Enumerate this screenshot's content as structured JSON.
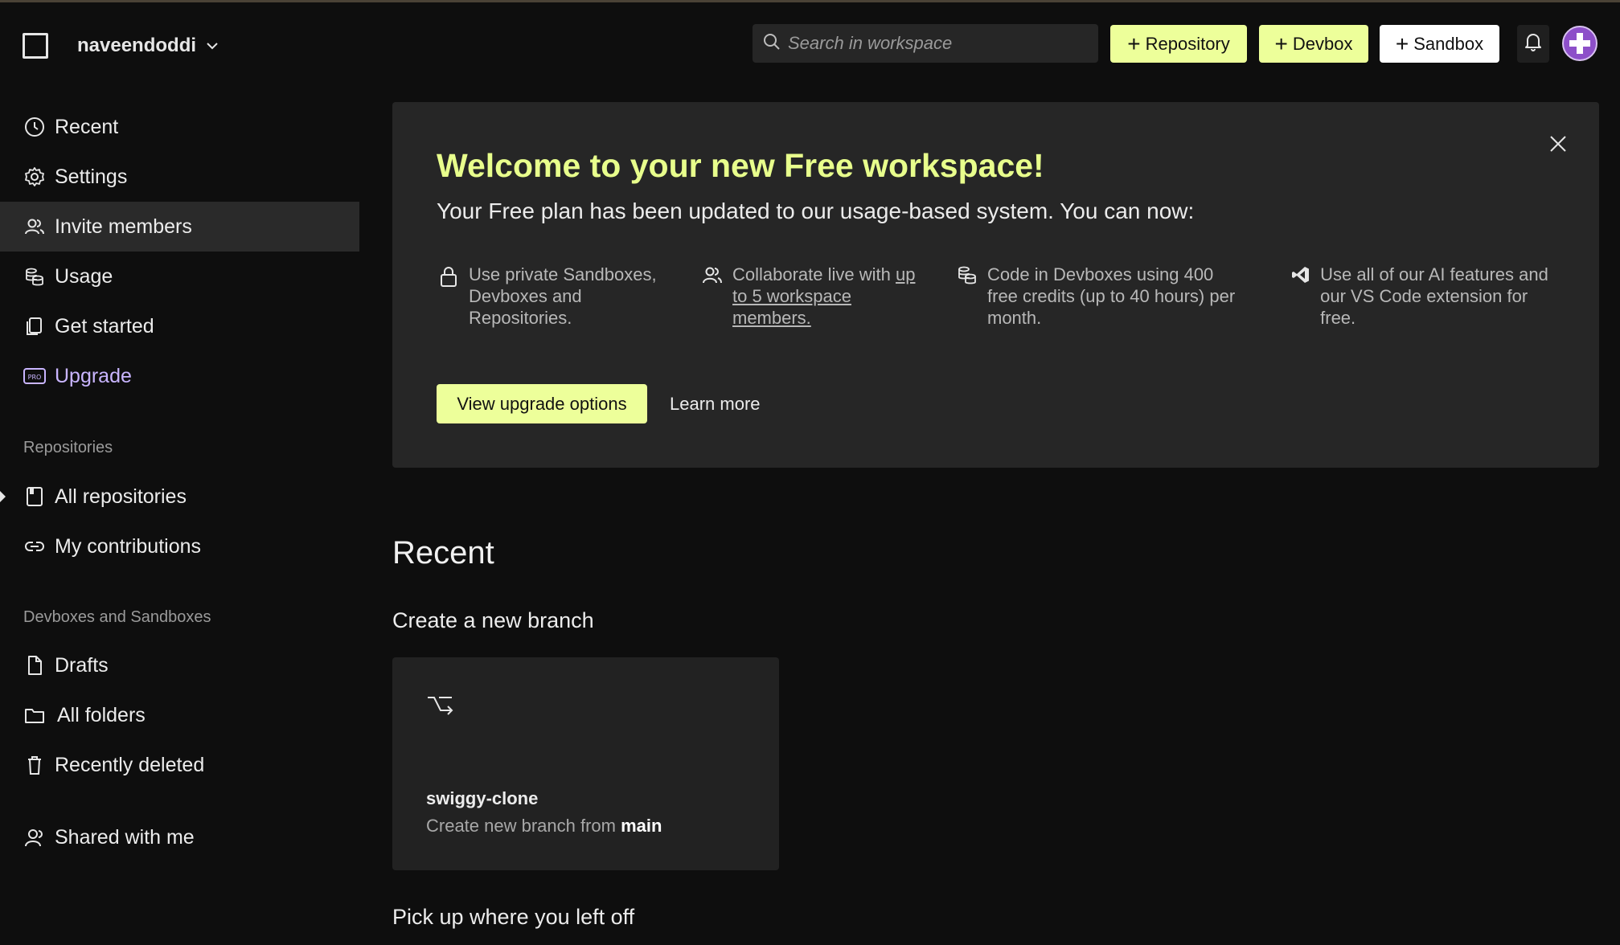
{
  "workspace": {
    "name": "naveendoddi"
  },
  "sidebar": {
    "items": [
      {
        "label": "Recent",
        "icon": "clock-icon"
      },
      {
        "label": "Settings",
        "icon": "gear-icon"
      },
      {
        "label": "Invite members",
        "icon": "users-icon",
        "active": true
      },
      {
        "label": "Usage",
        "icon": "coins-icon"
      },
      {
        "label": "Get started",
        "icon": "documents-icon"
      },
      {
        "label": "Upgrade",
        "icon": "pro-badge-icon"
      }
    ],
    "repos_heading": "Repositories",
    "repos": [
      {
        "label": "All repositories",
        "icon": "book-icon"
      },
      {
        "label": "My contributions",
        "icon": "link-icon"
      }
    ],
    "devboxes_heading": "Devboxes and Sandboxes",
    "devboxes": [
      {
        "label": "Drafts",
        "icon": "file-icon"
      },
      {
        "label": "All folders",
        "icon": "folder-icon"
      },
      {
        "label": "Recently deleted",
        "icon": "trash-icon"
      }
    ],
    "shared": {
      "label": "Shared with me",
      "icon": "user-icon"
    }
  },
  "header": {
    "search_placeholder": "Search in workspace",
    "buttons": {
      "repository": "Repository",
      "devbox": "Devbox",
      "sandbox": "Sandbox"
    }
  },
  "banner": {
    "title": "Welcome to your new Free workspace!",
    "subtitle": "Your Free plan has been updated to our usage-based system. You can now:",
    "features": [
      {
        "icon": "lock-icon",
        "text": "Use private Sandboxes, Devboxes and Repositories."
      },
      {
        "icon": "users-icon",
        "text_before": "Collaborate live with ",
        "link": "up to 5 workspace members."
      },
      {
        "icon": "coins-icon",
        "text": "Code in Devboxes using 400 free credits (up to 40 hours) per month."
      },
      {
        "icon": "vscode-icon",
        "text": "Use all of our AI features and our VS Code extension for free."
      }
    ],
    "primary_button": "View upgrade options",
    "secondary_link": "Learn more"
  },
  "recent": {
    "title": "Recent",
    "branch_heading": "Create a new branch",
    "card": {
      "repo": "swiggy-clone",
      "desc_prefix": "Create new branch from",
      "branch": "main"
    },
    "pickup_heading": "Pick up where you left off"
  },
  "colors": {
    "accent_lime": "#edff9a",
    "title_lime": "#e8ff8c",
    "upgrade_purple": "#c9b5ff"
  }
}
